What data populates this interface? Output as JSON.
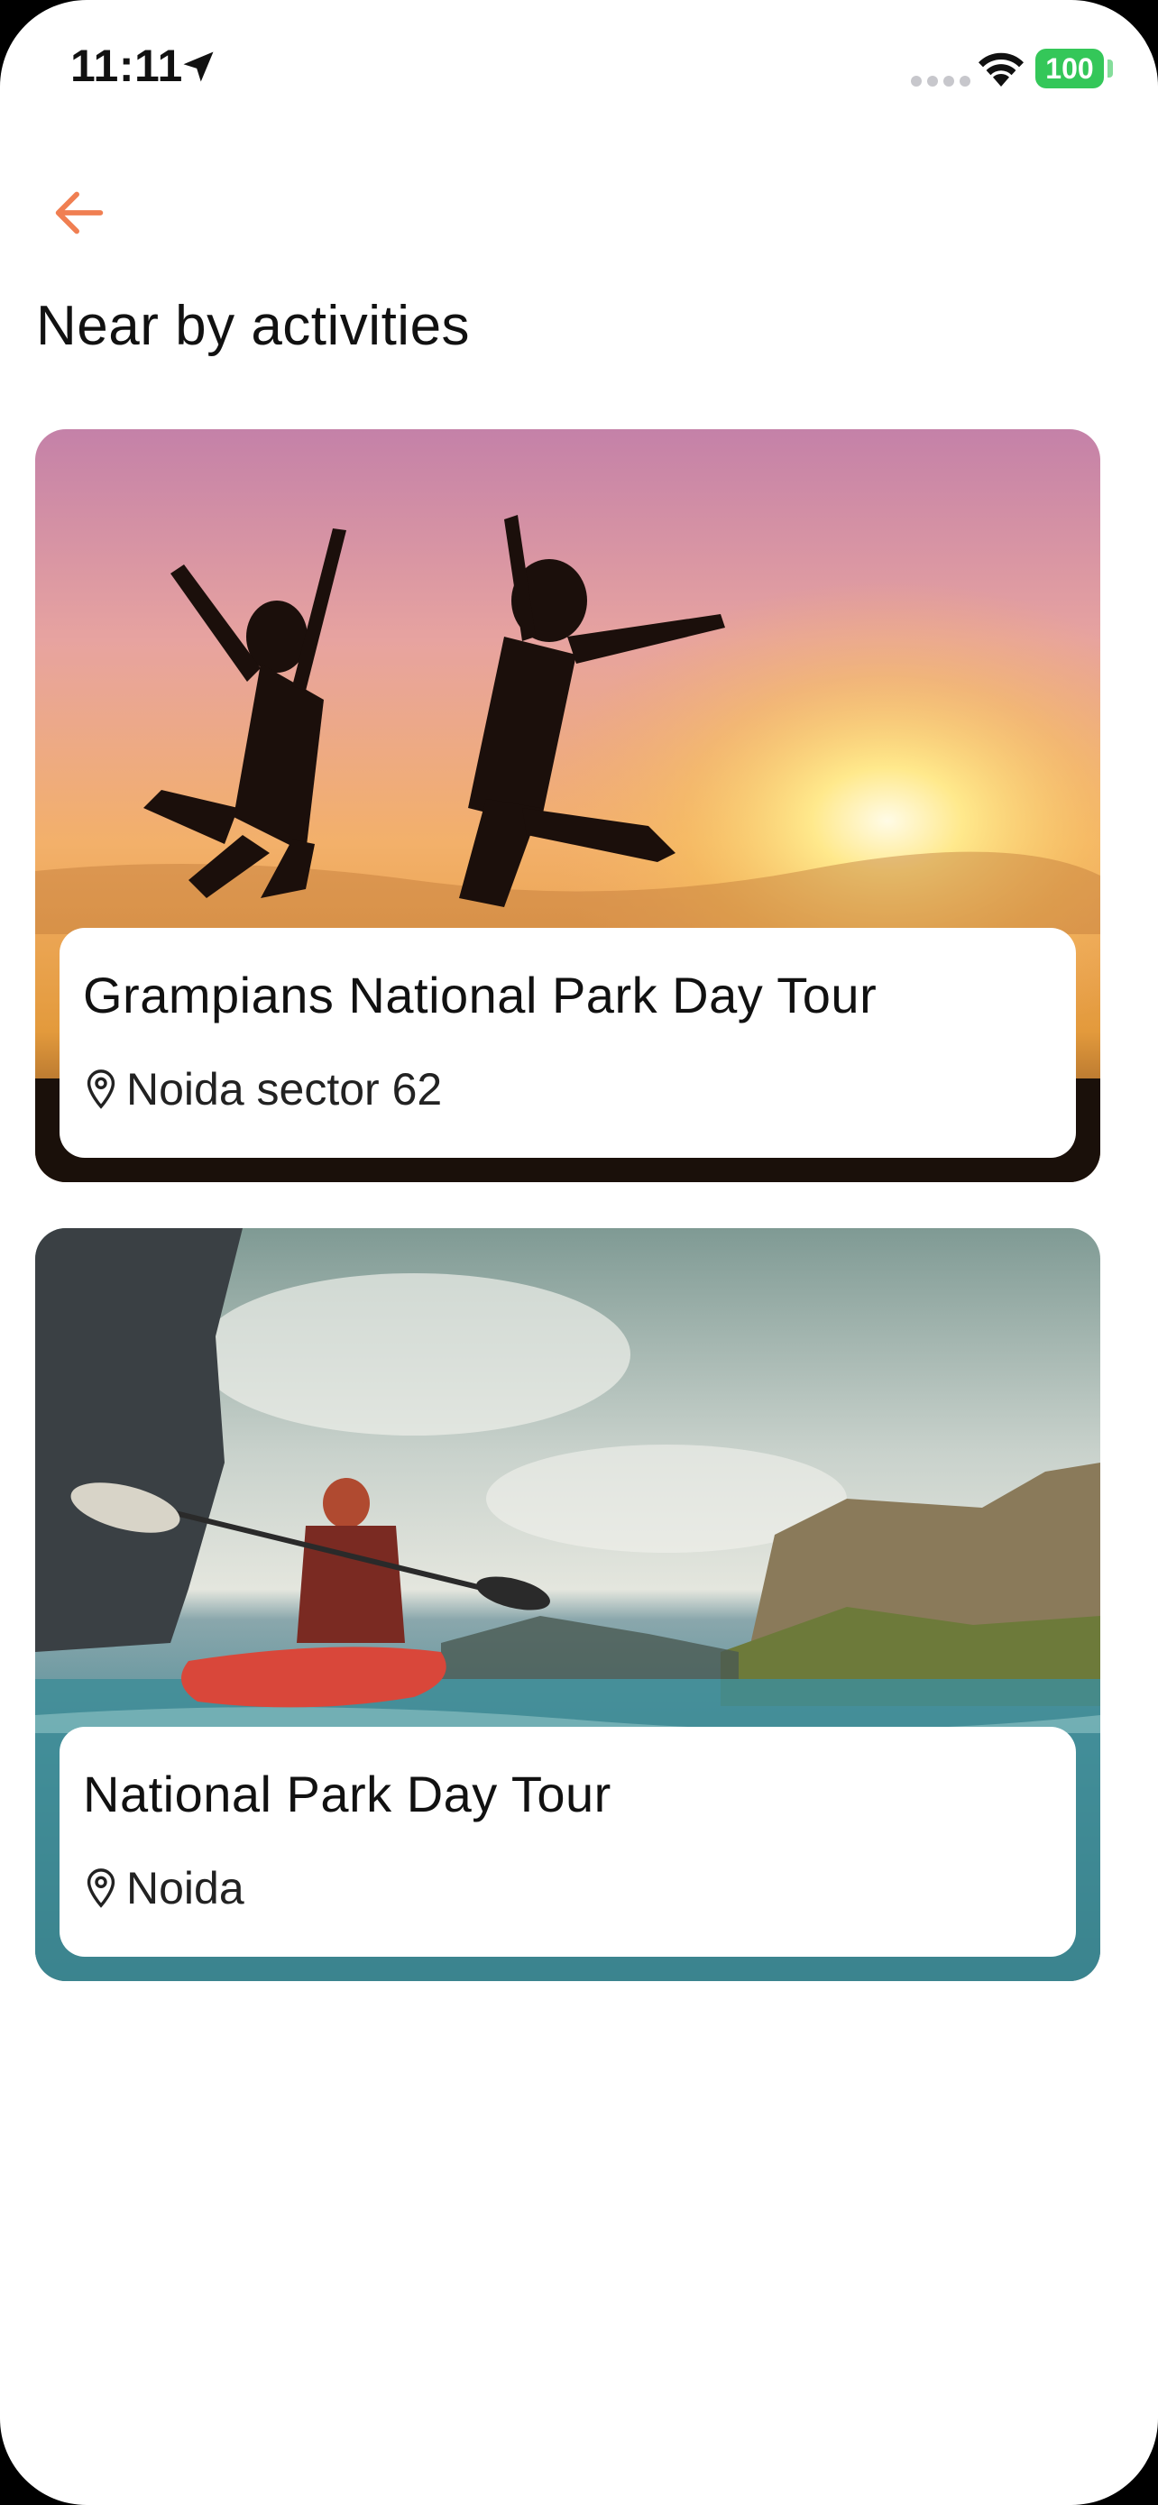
{
  "status_bar": {
    "time": "11:11",
    "battery": "100"
  },
  "header": {
    "title": "Near by activities"
  },
  "activities": [
    {
      "title": "Grampians National Park Day Tour",
      "location": "Noida sector 62"
    },
    {
      "title": "National Park Day Tour",
      "location": "Noida"
    }
  ],
  "colors": {
    "accent": "#F07F52",
    "battery": "#34C759"
  },
  "icons": {
    "back": "arrow-left-icon",
    "location": "map-pin-icon",
    "status_location": "location-arrow-icon",
    "wifi": "wifi-icon"
  }
}
